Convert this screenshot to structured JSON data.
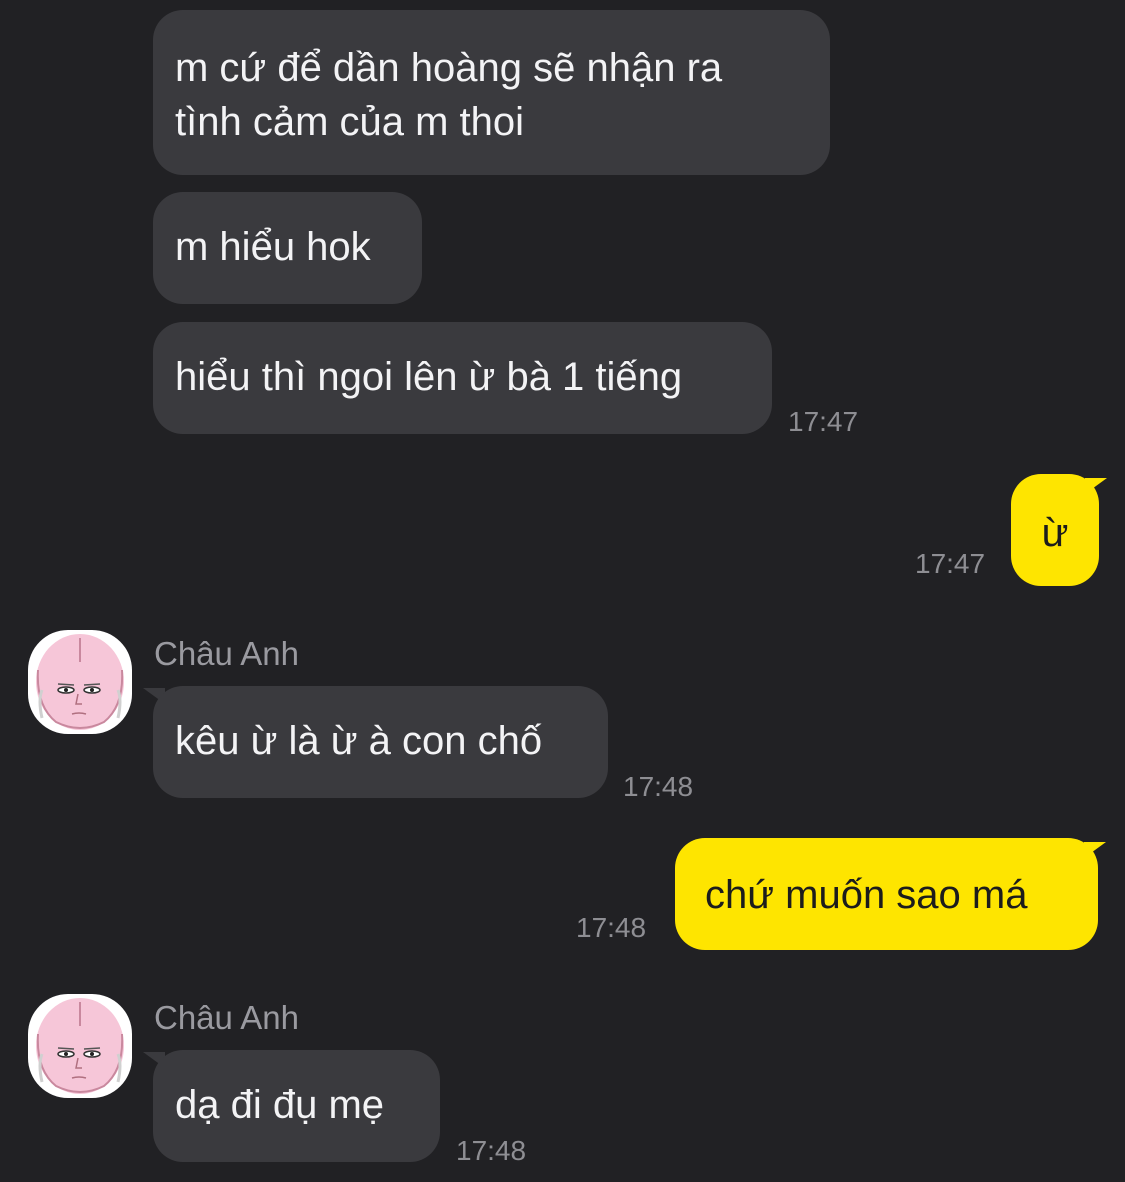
{
  "messages": [
    {
      "text": "m cứ để dần hoàng sẽ nhận ra\ntình cảm của m thoi",
      "from": "them"
    },
    {
      "text": "m hiểu hok",
      "from": "them"
    },
    {
      "text": "hiểu thì ngoi lên ừ bà 1 tiếng",
      "time": "17:47",
      "from": "them"
    },
    {
      "text": "ừ",
      "time": "17:47",
      "from": "me"
    },
    {
      "sender": "Châu Anh",
      "text": "kêu ừ là ừ à con chố",
      "time": "17:48",
      "from": "them"
    },
    {
      "text": "chứ muốn sao má",
      "time": "17:48",
      "from": "me"
    },
    {
      "sender": "Châu Anh",
      "text": "dạ đi đụ mẹ",
      "time": "17:48",
      "from": "them"
    }
  ],
  "colors": {
    "background": "#212124",
    "incoming_bubble": "#3a3a3e",
    "outgoing_bubble": "#fee500",
    "timestamp": "#8e8e93"
  },
  "icons": {
    "avatar": "pink-bald-cartoon-face-avatar"
  }
}
